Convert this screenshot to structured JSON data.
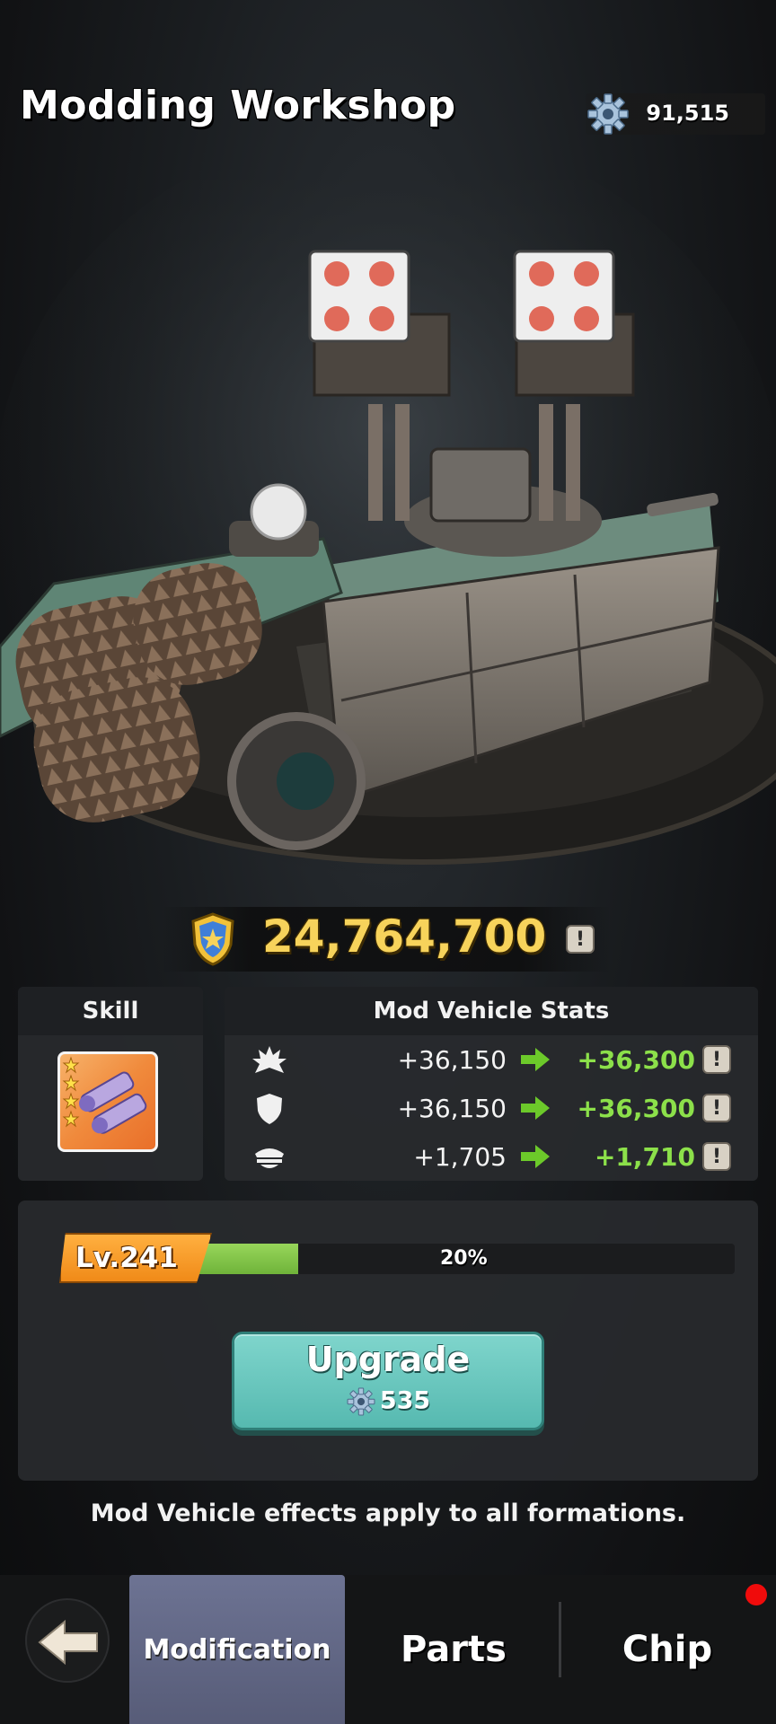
{
  "header": {
    "title": "Modding Workshop",
    "currency_amount": "91,515",
    "currency_icon": "gear-icon"
  },
  "power": {
    "value": "24,764,700",
    "icon": "shield-star-icon",
    "info_label": "!"
  },
  "skill": {
    "title": "Skill",
    "icon": "missile-skill-icon",
    "stars": 4
  },
  "stats": {
    "title": "Mod Vehicle Stats",
    "rows": [
      {
        "icon": "attack-icon",
        "current": "+36,150",
        "next": "+36,300",
        "info": "!"
      },
      {
        "icon": "defense-icon",
        "current": "+36,150",
        "next": "+36,300",
        "info": "!"
      },
      {
        "icon": "hp-icon",
        "current": "+1,705",
        "next": "+1,710",
        "info": "!"
      }
    ]
  },
  "level": {
    "label": "Lv.241",
    "progress_text": "20%",
    "progress": 0.2
  },
  "upgrade": {
    "label": "Upgrade",
    "cost": "535"
  },
  "note": "Mod Vehicle effects apply to all formations.",
  "nav": {
    "tabs": [
      {
        "label": "Modification",
        "active": true
      },
      {
        "label": "Parts",
        "active": false
      },
      {
        "label": "Chip",
        "active": false,
        "notification": true
      }
    ]
  },
  "colors": {
    "power_gold": "#f7d35b",
    "stat_green": "#8ce04a",
    "upgrade_teal": "#6cc9c0",
    "level_orange": "#f7a030",
    "notification_red": "#f00b0b"
  }
}
